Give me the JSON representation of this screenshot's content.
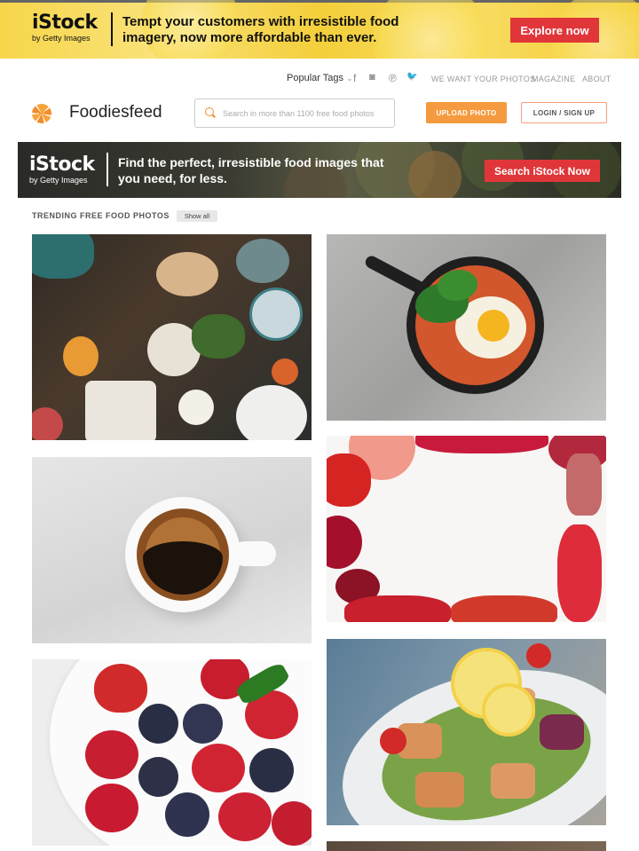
{
  "top_banner": {
    "brand": "iStock",
    "brand_sub": "by Getty Images",
    "headline": "Tempt your customers with irresistible food imagery, now more affordable than ever.",
    "cta": "Explore now"
  },
  "nav": {
    "popular_tags": "Popular Tags",
    "chevron": "⌄",
    "social": [
      "f",
      "◙",
      "℗",
      "🐦"
    ],
    "links": [
      "WE WANT YOUR PHOTOS",
      "MAGAZINE",
      "ABOUT"
    ]
  },
  "header": {
    "logo_text": "Foodiesfeed",
    "search_placeholder": "Search in more than 1100 free food photos",
    "upload_label": "UPLOAD PHOTO",
    "login_label": "LOGIN / SIGN UP"
  },
  "ad": {
    "brand": "iStock",
    "brand_sub": "by Getty Images",
    "text": "Find the perfect, irresistible food images that you need, for less.",
    "cta": "Search iStock Now"
  },
  "trending": {
    "title": "TRENDING FREE FOOD PHOTOS",
    "show_all": "Show all"
  },
  "photos": [
    {
      "subject": "table-spread"
    },
    {
      "subject": "egg-skillet"
    },
    {
      "subject": "coffee-cup"
    },
    {
      "subject": "fruit-frame"
    },
    {
      "subject": "berries"
    },
    {
      "subject": "salmon-salad"
    },
    {
      "subject": "wood-partial"
    }
  ],
  "colors": {
    "accent_orange": "#f59a3e",
    "istock_red": "#e0363a",
    "banner_yellow": "#f7d64a"
  }
}
